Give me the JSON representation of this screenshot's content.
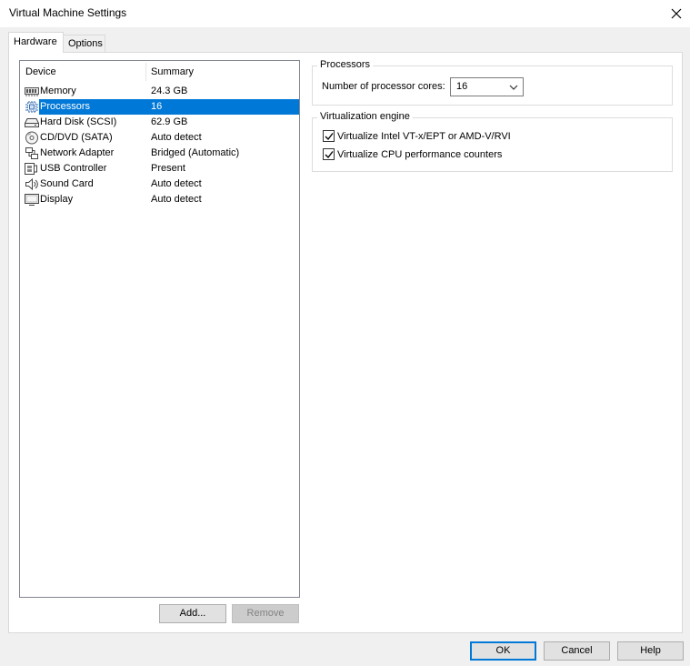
{
  "window": {
    "title": "Virtual Machine Settings"
  },
  "tabs": [
    {
      "label": "Hardware",
      "active": true
    },
    {
      "label": "Options",
      "active": false
    }
  ],
  "device_list": {
    "columns": [
      "Device",
      "Summary"
    ],
    "rows": [
      {
        "icon": "memory-icon",
        "device": "Memory",
        "summary": "24.3 GB",
        "selected": false
      },
      {
        "icon": "processor-icon",
        "device": "Processors",
        "summary": "16",
        "selected": true
      },
      {
        "icon": "hard-disk-icon",
        "device": "Hard Disk (SCSI)",
        "summary": "62.9 GB",
        "selected": false
      },
      {
        "icon": "cd-dvd-icon",
        "device": "CD/DVD (SATA)",
        "summary": "Auto detect",
        "selected": false
      },
      {
        "icon": "network-adapter-icon",
        "device": "Network Adapter",
        "summary": "Bridged (Automatic)",
        "selected": false
      },
      {
        "icon": "usb-controller-icon",
        "device": "USB Controller",
        "summary": "Present",
        "selected": false
      },
      {
        "icon": "sound-card-icon",
        "device": "Sound Card",
        "summary": "Auto detect",
        "selected": false
      },
      {
        "icon": "display-icon",
        "device": "Display",
        "summary": "Auto detect",
        "selected": false
      }
    ]
  },
  "list_buttons": {
    "add": "Add...",
    "remove": "Remove"
  },
  "processors_group": {
    "title": "Processors",
    "cores_label": "Number of processor cores:",
    "cores_value": "16"
  },
  "virtualization_group": {
    "title": "Virtualization engine",
    "options": [
      {
        "label": "Virtualize Intel VT-x/EPT or AMD-V/RVI",
        "checked": true
      },
      {
        "label": "Virtualize CPU performance counters",
        "checked": true
      }
    ]
  },
  "dialog_buttons": {
    "ok": "OK",
    "cancel": "Cancel",
    "help": "Help"
  },
  "colors": {
    "selection": "#0078d7",
    "default_button_border": "#0078d7"
  }
}
